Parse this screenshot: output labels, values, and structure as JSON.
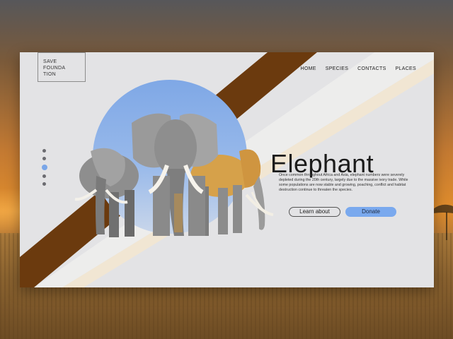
{
  "logo": {
    "line1": "SAVE",
    "line2": "FOUNDA",
    "line3": "TION"
  },
  "nav": {
    "home": "HOME",
    "species": "SPECIES",
    "contacts": "CONTACTS",
    "places": "PLACES"
  },
  "hero": {
    "title": "Elephant",
    "description": "Once common throughout Africa and Asia, elephant numbers were severely depleted during the 20th century, largely due to the massive ivory trade. While some populations are now stable and growing, poaching, conflict and habitat destruction continue to threaten the species."
  },
  "buttons": {
    "learn_about": "Learn about",
    "donate": "Donate"
  },
  "slider": {
    "count": 5,
    "active_index": 2
  },
  "colors": {
    "accent_blue": "#7aa9ee",
    "stripe_brown": "#6b3a0e",
    "card_bg": "#e3e3e5"
  }
}
